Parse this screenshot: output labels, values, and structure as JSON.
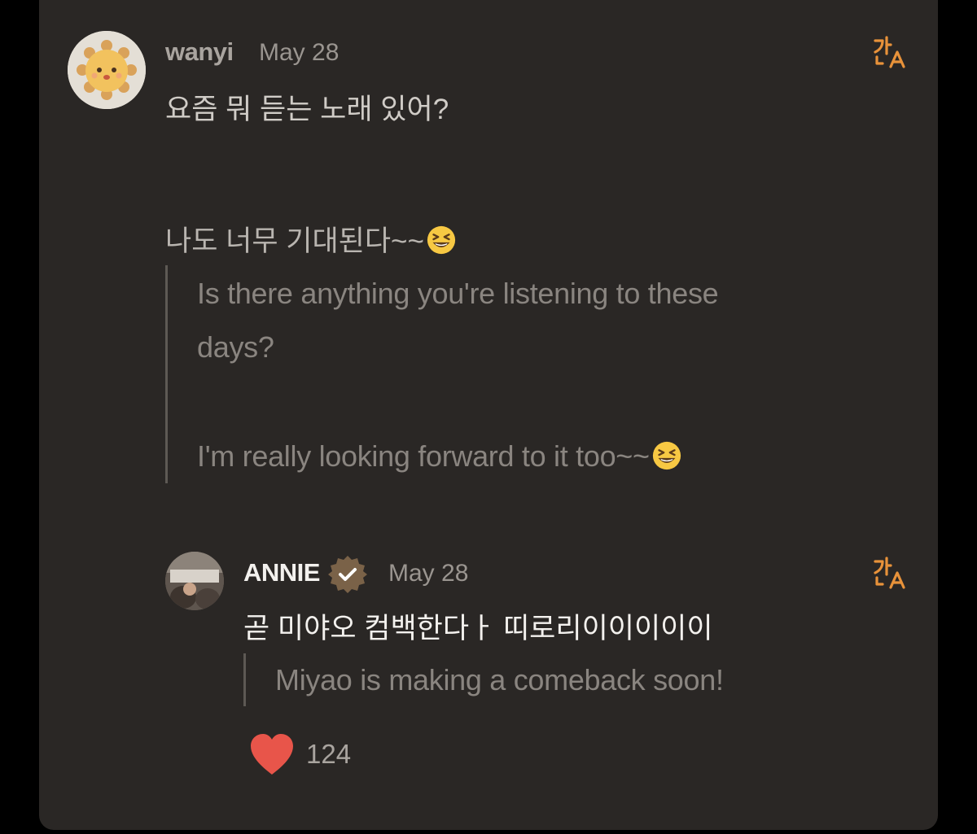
{
  "comment": {
    "username": "wanyi",
    "date": "May 28",
    "line1_ko": "요즘 뭐 듣는 노래 있어?",
    "line2_ko": "나도 너무 기대된다~~",
    "translation": {
      "line1a": "Is there anything you're listening to these",
      "line1b": "days?",
      "line2": "I'm really looking forward to it too~~"
    },
    "avatar_icon": "sun-character-icon",
    "translate_icon": "translate-icon"
  },
  "reply": {
    "username": "ANNIE",
    "verified_icon": "verified-badge-icon",
    "date": "May 28",
    "text_ko": "곧 미야오 컴백한다ㅏ 띠로리이이이이이",
    "translation": "Miyao is making a comeback soon!",
    "translate_icon": "translate-icon",
    "like_icon": "heart-icon",
    "like_count": "124"
  },
  "colors": {
    "background": "#000000",
    "card": "#2a2725",
    "accent_orange": "#e8923a",
    "heart_red": "#e8554a",
    "verified_brown": "#7a6248"
  },
  "emoji": "grinning-squinting-face-emoji"
}
